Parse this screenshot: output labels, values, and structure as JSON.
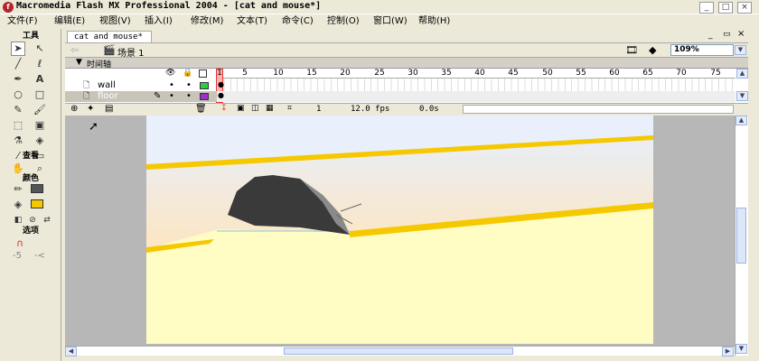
{
  "window": {
    "title": "Macromedia Flash MX Professional 2004 - [cat and mouse*]",
    "controls": {
      "minimize": "_",
      "maximize": "□",
      "close": "×"
    }
  },
  "menu": [
    "文件(F)",
    "编辑(E)",
    "视图(V)",
    "插入(I)",
    "修改(M)",
    "文本(T)",
    "命令(C)",
    "控制(O)",
    "窗口(W)",
    "帮助(H)"
  ],
  "tools": {
    "header": "工具",
    "view_label": "查看",
    "colors_label": "颜色",
    "options_label": "选项",
    "option_glyphs": [
      "-5",
      "-<"
    ]
  },
  "document": {
    "tab": "cat and mouse*",
    "scene": "场景 1",
    "zoom": "109%",
    "doc_controls": {
      "minimize": "_",
      "restore": "▭",
      "close": "×"
    }
  },
  "timeline": {
    "label": "时间轴",
    "frame_numbers": [
      "1",
      "5",
      "10",
      "15",
      "20",
      "25",
      "30",
      "35",
      "40",
      "45",
      "50",
      "55",
      "60",
      "65",
      "70",
      "75"
    ],
    "layers": [
      {
        "name": "wall",
        "color": "#2ECC40",
        "selected": false
      },
      {
        "name": "floor",
        "color": "#9B30C8",
        "selected": true
      }
    ],
    "current_frame": "1",
    "fps": "12.0 fps",
    "time": "0.0s"
  },
  "colors": {
    "stage_bg": "#FFFCC4",
    "stripe": "#F5C800",
    "mouse_body": "#3A3A3A",
    "stage_gray": "#B7B7B7",
    "playhead": "#E33"
  }
}
